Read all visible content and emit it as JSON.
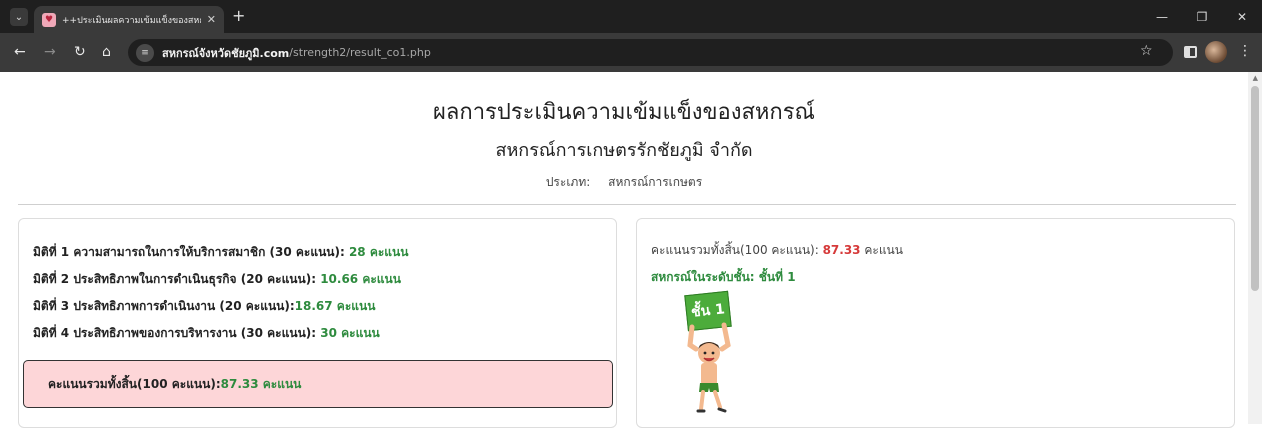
{
  "browser": {
    "tab_title": "++ประเมินผลความเข้มแข็งของสหกร",
    "url_host": "สหกรณ์จังหวัดชัยภูมิ.com",
    "url_path": "/strength2/result_co1.php"
  },
  "page": {
    "title": "ผลการประเมินความเข้มแข็งของสหกรณ์",
    "subtitle": "สหกรณ์การเกษตรรักชัยภูมิ จำกัด",
    "type_label": "ประเภท:",
    "type_value": "สหกรณ์การเกษตร"
  },
  "dimensions": [
    {
      "label": "มิติที่ 1 ความสามารถในการให้บริการสมาชิก (30 คะแนน): ",
      "score": "28 คะแนน"
    },
    {
      "label": "มิติที่ 2 ประสิทธิภาพในการดำเนินธุรกิจ (20 คะแนน): ",
      "score": "10.66 คะแนน"
    },
    {
      "label": "มิติที่ 3 ประสิทธิภาพการดำเนินงาน (20 คะแนน):",
      "score": "18.67 คะแนน"
    },
    {
      "label": "มิติที่ 4 ประสิทธิภาพของการบริหารงาน (30 คะแนน): ",
      "score": "30 คะแนน"
    }
  ],
  "total_box": {
    "label": "คะแนนรวมทั้งสิ้น(100 คะแนน): ",
    "score": "87.33 คะแนน"
  },
  "result": {
    "total_label": "คะแนนรวมทั้งสิ้น(100 คะแนน): ",
    "total_value": "87.33",
    "total_unit": " คะแนน",
    "level_text": "สหกรณ์ในระดับชั้น: ชั้นที่ 1",
    "sign_text": "ชั้น 1"
  },
  "colors": {
    "score_green": "#2e8b3e",
    "score_red": "#d63a3a",
    "total_box_bg": "#fdd6d8"
  }
}
